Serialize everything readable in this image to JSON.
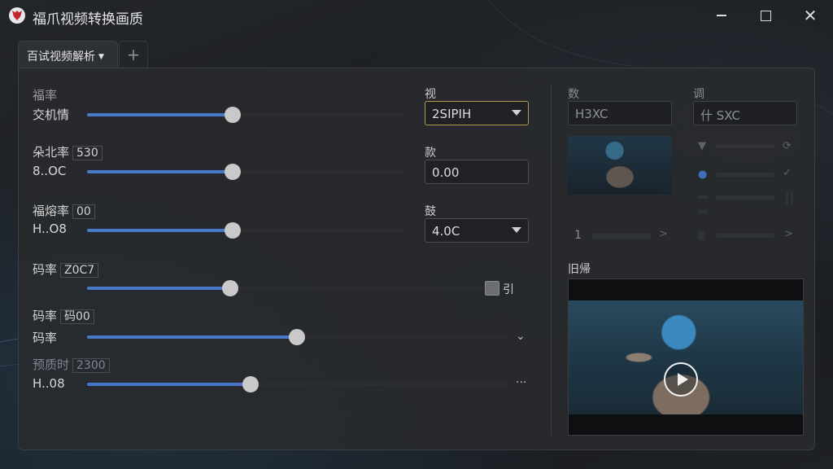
{
  "window": {
    "title": "福爪视频转换画质",
    "minimize_icon": "minimize-icon",
    "maximize_icon": "maximize-icon",
    "close_icon": "close-icon"
  },
  "tabs": [
    {
      "label": "百试视频解析"
    },
    {
      "label": "+"
    }
  ],
  "accent_color": "#4a78c8",
  "settings": [
    {
      "label": "福率",
      "value_label": "交机情",
      "level": 0.46
    },
    {
      "label": "朵北率",
      "tag": "530",
      "value_label": "8..OC",
      "level": 0.46
    },
    {
      "label": "福熔率",
      "tag": "00",
      "value_label": "H..O8",
      "level": 0.46
    },
    {
      "label": "码率",
      "tag": "Z0C7",
      "value_label": "",
      "level": 0.36,
      "checkbox_label": "引"
    },
    {
      "label": "码率",
      "tag": "码00",
      "value_label": "码率",
      "level": 0.5
    },
    {
      "label": "预质时",
      "tag": "2300",
      "value_label": "H..08",
      "level": 0.39
    }
  ],
  "fields": [
    {
      "label": "视",
      "value": "2SIPIH"
    },
    {
      "label": "款",
      "value": "0.00"
    },
    {
      "label": "鼓",
      "value": "4.0C"
    }
  ],
  "right_panel": {
    "col1_label": "数",
    "col1_value": "H3XC",
    "col2_label": "调",
    "col2_value": "什 SXC",
    "page_number": "1",
    "preview_label": "旧帰"
  }
}
